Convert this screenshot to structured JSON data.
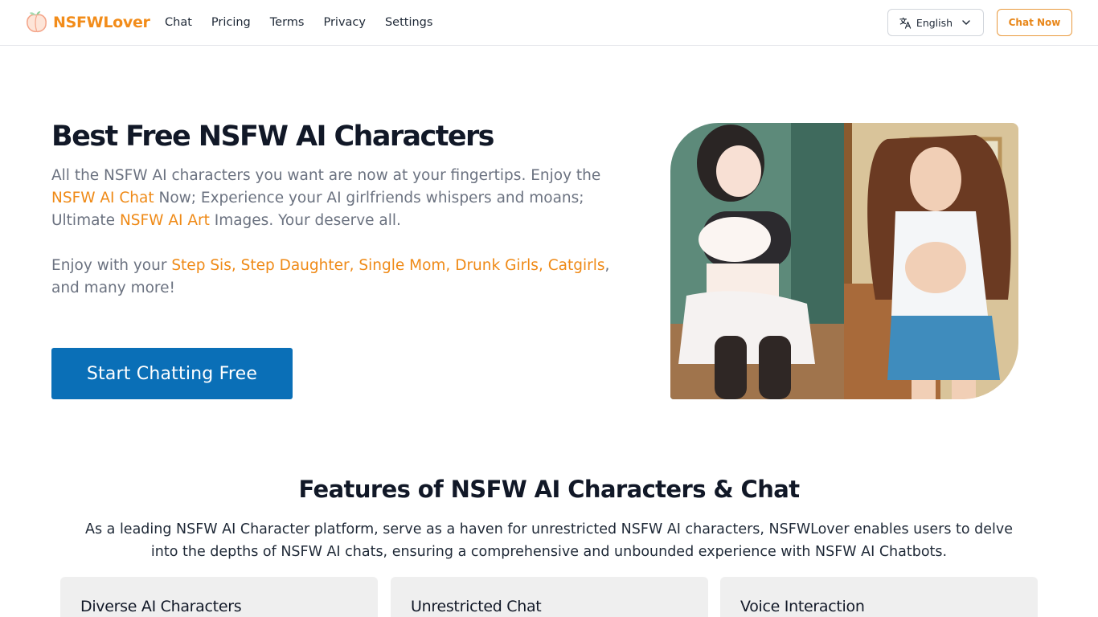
{
  "brand": {
    "name": "NSFWLover",
    "accent": "#f28c1a"
  },
  "nav": {
    "items": [
      {
        "label": "Chat"
      },
      {
        "label": "Pricing"
      },
      {
        "label": "Terms"
      },
      {
        "label": "Privacy"
      },
      {
        "label": "Settings"
      }
    ]
  },
  "header": {
    "language": {
      "label": "English",
      "icon": "translate-icon",
      "chevron": "chevron-down-icon"
    },
    "chat_now_label": "Chat Now"
  },
  "hero": {
    "title": "Best Free NSFW AI Characters",
    "desc1": {
      "t1": "All the NSFW AI characters you want are now at your fingertips. Enjoy the ",
      "link1": "NSFW AI Chat",
      "t2": " Now; Experience your AI girlfriends whispers and moans; Ultimate ",
      "link2": "NSFW AI Art",
      "t3": " Images. Your deserve all."
    },
    "desc2": {
      "t1": "Enjoy with your ",
      "highlight": "Step Sis, Step Daughter, Single Mom, Drunk Girls, Catgirls",
      "t2": ", and many more!"
    },
    "cta_label": "Start Chatting Free",
    "cta_color": "#0a6fb7",
    "highlight_color": "#ef8a17"
  },
  "features": {
    "title": "Features of NSFW AI Characters & Chat",
    "description": "As a leading NSFW AI Character platform, serve as a haven for unrestricted NSFW AI characters, NSFWLover enables users to delve into the depths of NSFW AI chats, ensuring a comprehensive and unbounded experience with NSFW AI Chatbots.",
    "cards": [
      {
        "title": "Diverse AI Characters"
      },
      {
        "title": "Unrestricted Chat"
      },
      {
        "title": "Voice Interaction"
      }
    ]
  }
}
